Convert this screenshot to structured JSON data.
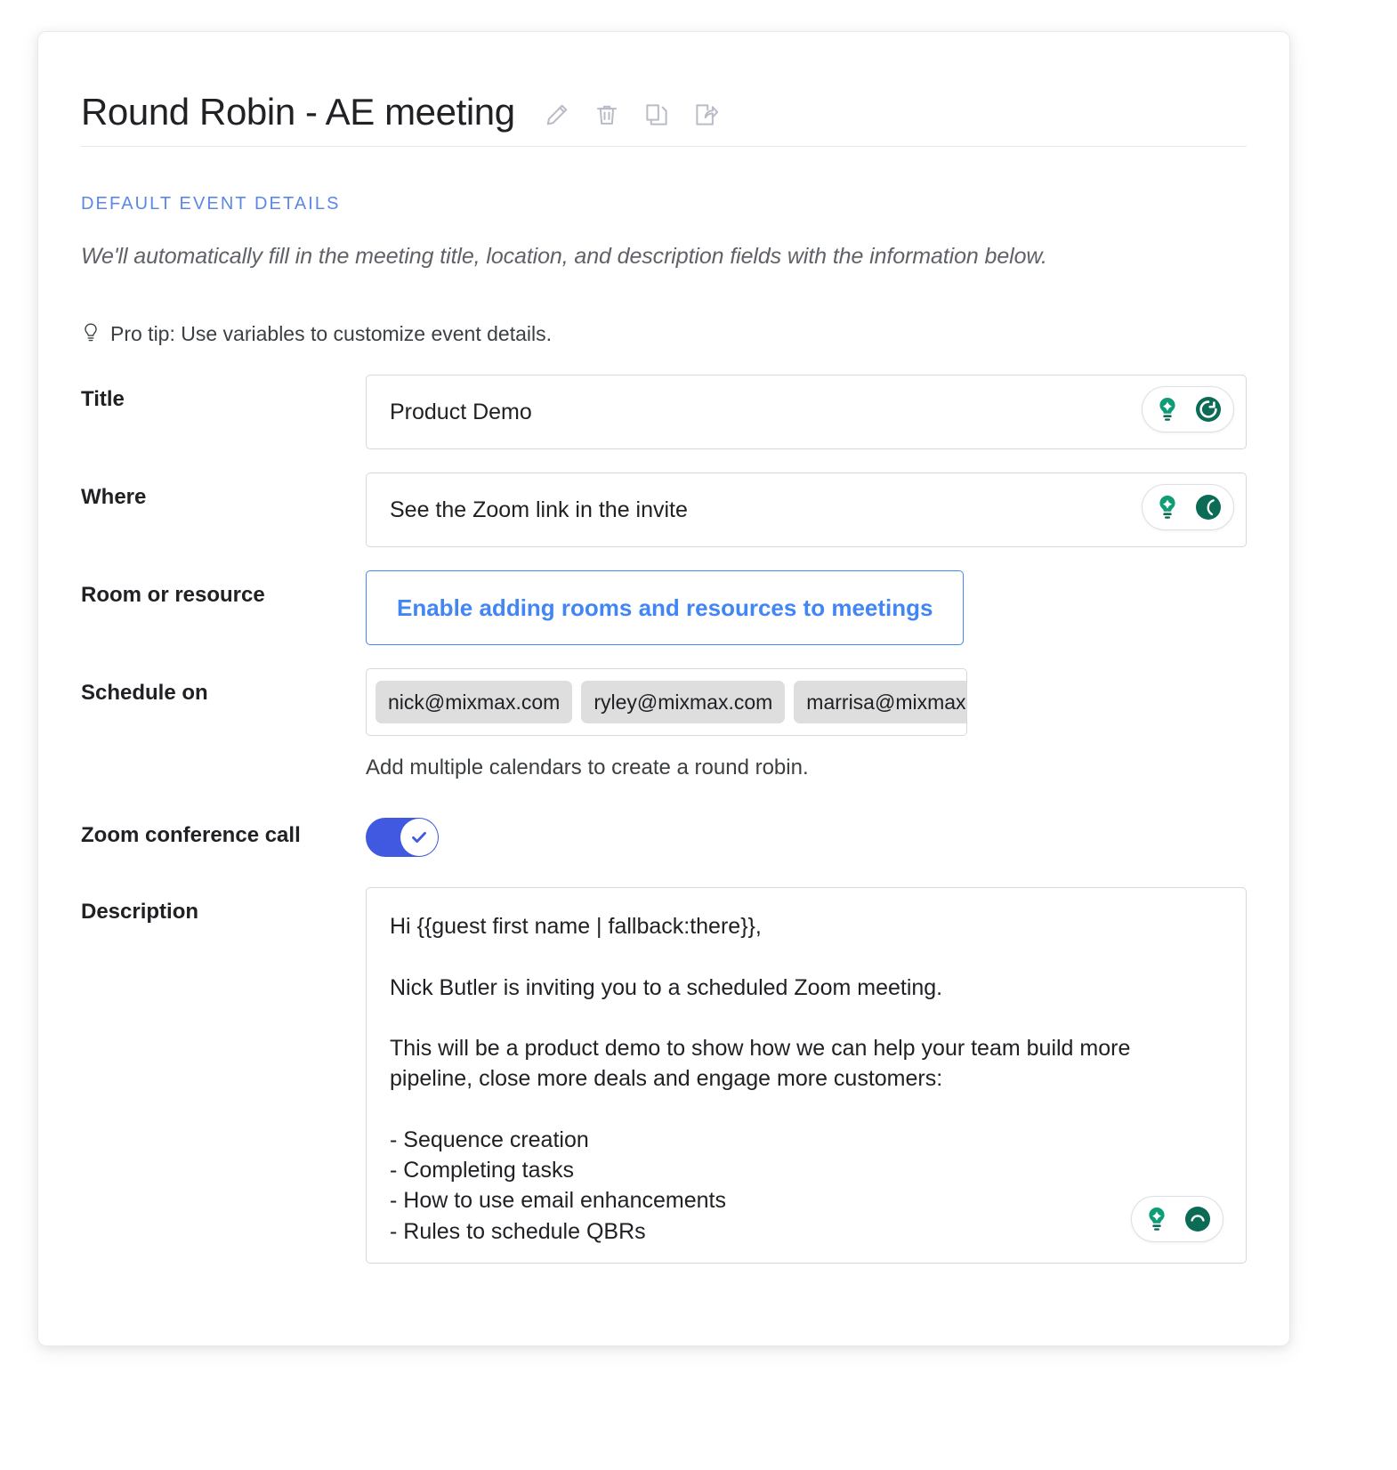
{
  "header": {
    "title": "Round Robin - AE meeting",
    "icons": [
      {
        "name": "edit-pencil-icon",
        "label": "Edit"
      },
      {
        "name": "trash-icon",
        "label": "Delete"
      },
      {
        "name": "duplicate-icon",
        "label": "Duplicate"
      },
      {
        "name": "share-icon",
        "label": "Share"
      }
    ]
  },
  "section": {
    "label": "DEFAULT EVENT DETAILS",
    "description": "We'll automatically fill in the meeting title, location, and description fields with the information below.",
    "pro_tip": "Pro tip: Use variables to customize event details."
  },
  "fields": {
    "title": {
      "label": "Title",
      "value": "Product Demo"
    },
    "where": {
      "label": "Where",
      "value": "See the Zoom link in the invite"
    },
    "room": {
      "label": "Room or resource",
      "button_label": "Enable adding rooms and resources to meetings"
    },
    "schedule_on": {
      "label": "Schedule on",
      "chips": [
        "nick@mixmax.com",
        "ryley@mixmax.com",
        "marrisa@mixmax.c"
      ],
      "helper": "Add multiple calendars to create a round robin."
    },
    "zoom_call": {
      "label": "Zoom conference call",
      "enabled": true
    },
    "description": {
      "label": "Description",
      "value": "Hi {{guest first name | fallback:there}},\n\nNick Butler is inviting you to a scheduled Zoom meeting.\n\nThis will be a product demo to show how we can help your team build more\npipeline, close more deals and engage more customers:\n\n- Sequence creation\n- Completing tasks\n- How to use email enhancements\n- Rules to schedule QBRs"
    }
  },
  "colors": {
    "accent_blue": "#4285f4",
    "section_blue": "#5b87e8",
    "toggle_blue": "#4059e0",
    "icon_green": "#0f9d77",
    "icon_dark_green": "#0b6b55",
    "text": "#202124",
    "muted": "#5f6368",
    "border": "#d5d8de",
    "chip_bg": "#dedede"
  }
}
